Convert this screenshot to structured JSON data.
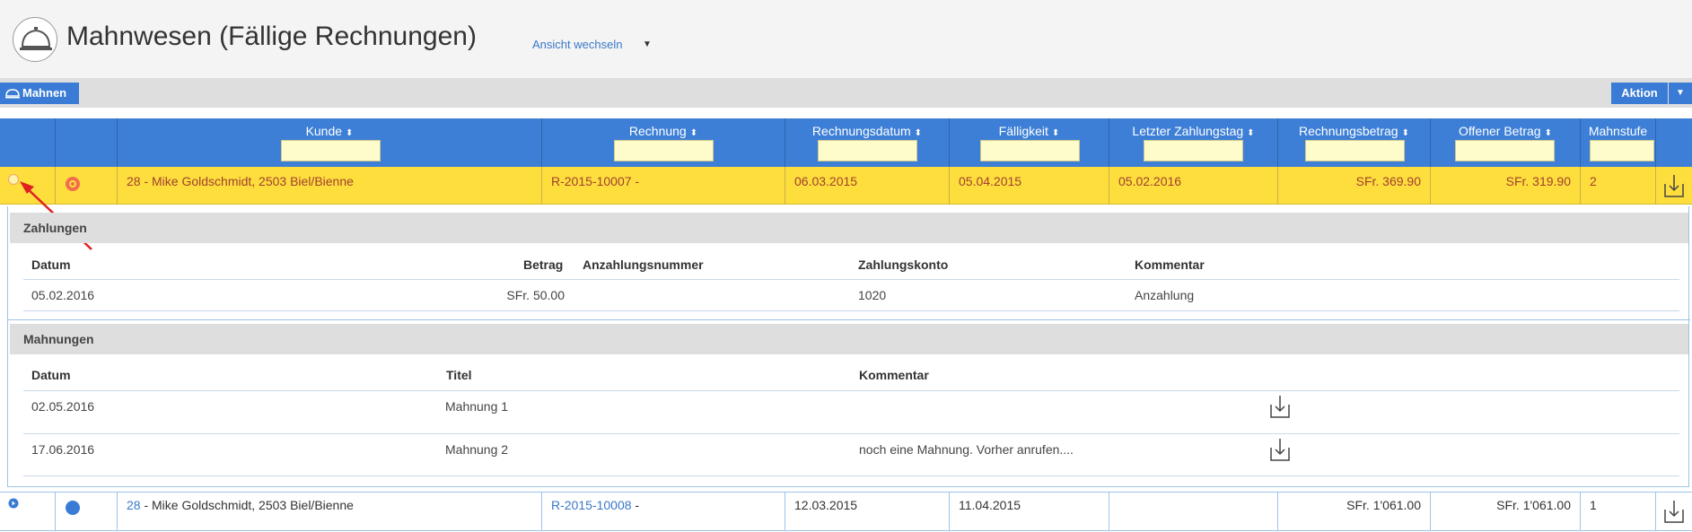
{
  "header": {
    "title": "Mahnwesen (Fällige Rechnungen)",
    "view_switch": "Ansicht wechseln",
    "view_caret": "▼",
    "logo_icon": "service-bell-icon"
  },
  "toolbar": {
    "mahnen_label": "Mahnen",
    "aktion_label": "Aktion",
    "aktion_caret": "▼"
  },
  "columns": [
    {
      "label": "Kunde",
      "sort": "⬍"
    },
    {
      "label": "Rechnung",
      "sort": "⬍"
    },
    {
      "label": "Rechnungsdatum",
      "sort": "⬍"
    },
    {
      "label": "Fälligkeit",
      "sort": "⬍"
    },
    {
      "label": "Letzter Zahlungstag",
      "sort": "⬍"
    },
    {
      "label": "Rechnungsbetrag",
      "sort": "⬍"
    },
    {
      "label": "Offener Betrag",
      "sort": "⬍"
    },
    {
      "label": "Mahnstufe",
      "sort": ""
    }
  ],
  "rows": [
    {
      "kunde_nr": "28",
      "kunde_rest": " - Mike Goldschmidt, 2503 Biel/Bienne",
      "rechnung_nr": "R-2015-10007",
      "rechnung_suffix": " -",
      "rechnungsdatum": "06.03.2015",
      "faelligkeit": "05.04.2015",
      "letzter_zahlungstag": "05.02.2016",
      "rechnungsbetrag": "SFr. 369.90",
      "offener_betrag": "SFr. 319.90",
      "mahnstufe": "2",
      "selected": true
    },
    {
      "kunde_nr": "28",
      "kunde_rest": " - Mike Goldschmidt, 2503 Biel/Bienne",
      "rechnung_nr": "R-2015-10008",
      "rechnung_suffix": " -",
      "rechnungsdatum": "12.03.2015",
      "faelligkeit": "11.04.2015",
      "letzter_zahlungstag": "",
      "rechnungsbetrag": "SFr. 1'061.00",
      "offener_betrag": "SFr. 1'061.00",
      "mahnstufe": "1",
      "selected": false
    }
  ],
  "zahlungen": {
    "title": "Zahlungen",
    "headers": {
      "datum": "Datum",
      "betrag": "Betrag",
      "anzahlungsnummer": "Anzahlungsnummer",
      "zahlungskonto": "Zahlungskonto",
      "kommentar": "Kommentar"
    },
    "rows": [
      {
        "datum": "05.02.2016",
        "betrag": "SFr. 50.00",
        "anzahlungsnummer": "",
        "zahlungskonto": "1020",
        "kommentar": "Anzahlung"
      }
    ]
  },
  "mahnungen": {
    "title": "Mahnungen",
    "headers": {
      "datum": "Datum",
      "titel": "Titel",
      "kommentar": "Kommentar"
    },
    "rows": [
      {
        "datum": "02.05.2016",
        "titel": "Mahnung 1",
        "kommentar": ""
      },
      {
        "datum": "17.06.2016",
        "titel": "Mahnung 2",
        "kommentar": "noch eine Mahnung. Vorher anrufen...."
      }
    ]
  },
  "colors": {
    "header_blue": "#3d7fd6",
    "selected_row": "#fede3c",
    "status_orange": "#f26d4f",
    "status_blue": "#3a7bd5",
    "annotation_red": "#e02020"
  }
}
